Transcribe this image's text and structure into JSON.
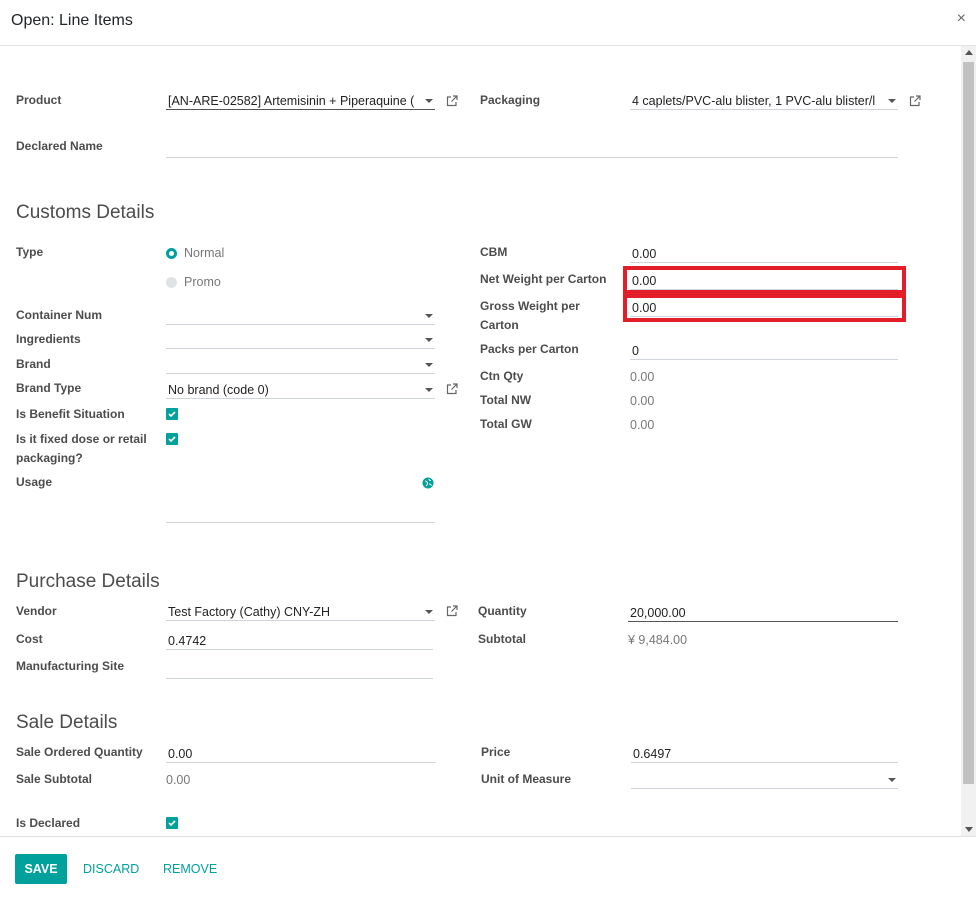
{
  "dialog": {
    "title": "Open: Line Items",
    "close_glyph": "×"
  },
  "top": {
    "product_label": "Product",
    "product_value": "[AN-ARE-02582] Artemisinin + Piperaquine (",
    "packaging_label": "Packaging",
    "packaging_value": "4 caplets/PVC-alu blister, 1 PVC-alu blister/l",
    "declared_name_label": "Declared Name",
    "declared_name_value": ""
  },
  "customs": {
    "heading": "Customs Details",
    "type_label": "Type",
    "type_options": [
      "Normal",
      "Promo"
    ],
    "type_selected": "Normal",
    "container_num_label": "Container Num",
    "ingredients_label": "Ingredients",
    "brand_label": "Brand",
    "brand_type_label": "Brand Type",
    "brand_type_value": "No brand (code 0)",
    "benefit_label": "Is Benefit Situation",
    "fixed_dose_label": "Is it fixed dose or retail packaging?",
    "usage_label": "Usage",
    "cbm_label": "CBM",
    "cbm_value": "0.00",
    "net_weight_label": "Net Weight per Carton",
    "net_weight_value": "0.00",
    "gross_weight_label": "Gross Weight per Carton",
    "gross_weight_value": "0.00",
    "packs_label": "Packs per Carton",
    "packs_value": "0",
    "ctn_qty_label": "Ctn Qty",
    "ctn_qty_value": "0.00",
    "total_nw_label": "Total NW",
    "total_nw_value": "0.00",
    "total_gw_label": "Total GW",
    "total_gw_value": "0.00"
  },
  "purchase": {
    "heading": "Purchase Details",
    "vendor_label": "Vendor",
    "vendor_value": "Test Factory (Cathy) CNY-ZH",
    "cost_label": "Cost",
    "cost_value": "0.4742",
    "site_label": "Manufacturing Site",
    "quantity_label": "Quantity",
    "quantity_value": "20,000.00",
    "subtotal_label": "Subtotal",
    "subtotal_value": "¥ 9,484.00"
  },
  "sale": {
    "heading": "Sale Details",
    "ordered_qty_label": "Sale Ordered Quantity",
    "ordered_qty_value": "0.00",
    "subtotal_label": "Sale Subtotal",
    "subtotal_value": "0.00",
    "declared_label": "Is Declared",
    "price_label": "Price",
    "price_value": "0.6497",
    "uom_label": "Unit of Measure"
  },
  "footer": {
    "save": "SAVE",
    "discard": "DISCARD",
    "remove": "REMOVE"
  },
  "colors": {
    "accent": "#00a09d",
    "highlight": "#e21f28"
  }
}
